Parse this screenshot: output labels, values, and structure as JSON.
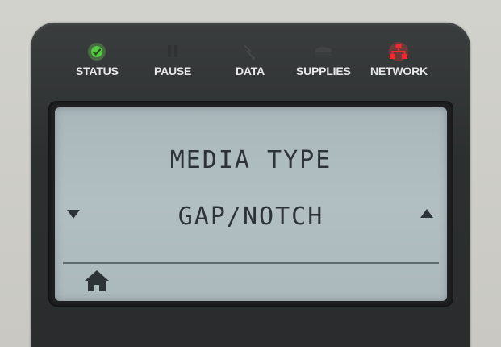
{
  "indicators": [
    {
      "label": "STATUS",
      "icon": "status-icon",
      "color": "#4fbe3f",
      "state": "on"
    },
    {
      "label": "PAUSE",
      "icon": "pause-icon",
      "color": "#3a3d3e",
      "state": "off"
    },
    {
      "label": "DATA",
      "icon": "data-icon",
      "color": "#3a3d3e",
      "state": "off"
    },
    {
      "label": "SUPPLIES",
      "icon": "supplies-icon",
      "color": "#3a3d3e",
      "state": "off"
    },
    {
      "label": "NETWORK",
      "icon": "network-icon",
      "color": "#e0262a",
      "state": "on"
    }
  ],
  "lcd": {
    "title": "MEDIA TYPE",
    "value": "GAP/NOTCH",
    "left_icon": "down-arrow-icon",
    "right_icon": "up-arrow-icon",
    "footer_icon": "home-icon"
  }
}
